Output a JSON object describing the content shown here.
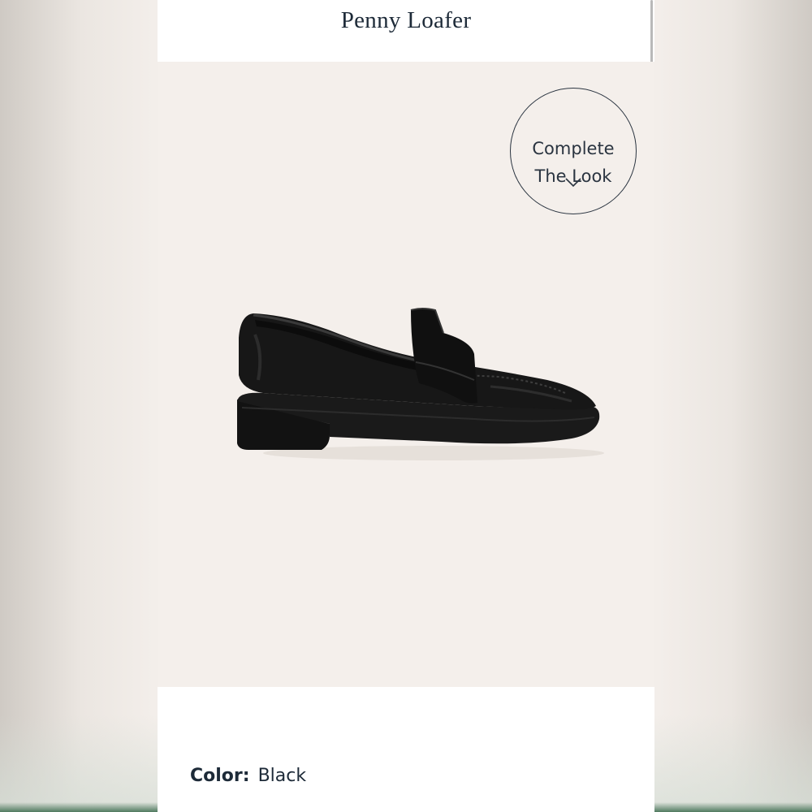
{
  "product": {
    "title": "Penny Loafer"
  },
  "complete_the_look": {
    "line1": "Complete",
    "line2": "The Look",
    "icon": "chevron-down-icon"
  },
  "product_image": {
    "subject": "black leather penny loafer"
  },
  "color": {
    "label": "Color:",
    "value": "Black"
  },
  "colors": {
    "title_text": "#1d2a38",
    "hero_background": "#f4efeb",
    "shoe": "#141414"
  }
}
